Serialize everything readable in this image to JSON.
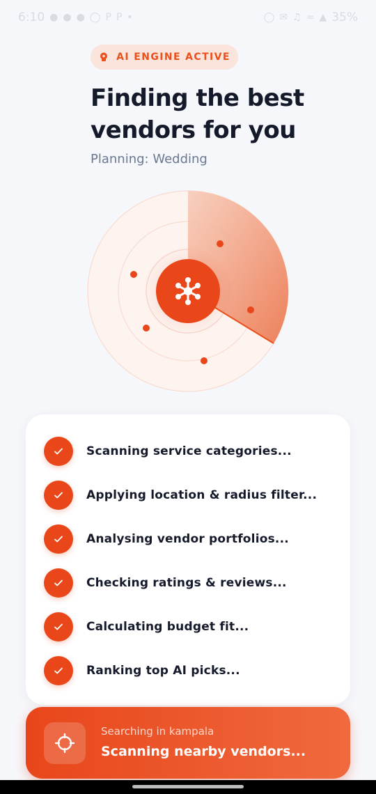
{
  "status_bar": {
    "time": "6:10",
    "left_icons": [
      "snapchat-icon",
      "snapchat-icon",
      "snapchat-icon",
      "alarm-icon",
      "p-icon",
      "p-icon",
      "dot-icon"
    ],
    "right_icons": [
      "alarm-icon",
      "mail-icon",
      "mute-icon",
      "wifi-icon",
      "signal-icon"
    ],
    "battery": "35%"
  },
  "badge": {
    "label": "AI ENGINE ACTIVE",
    "icon": "brain-icon"
  },
  "title": "Finding the best vendors for you",
  "subtitle": "Planning: Wedding",
  "radar": {
    "center_icon": "network-hub-icon",
    "accent": "#e9471a"
  },
  "checklist": {
    "items": [
      {
        "label": "Scanning service categories...",
        "done": true
      },
      {
        "label": "Applying location & radius filter...",
        "done": true
      },
      {
        "label": "Analysing vendor portfolios...",
        "done": true
      },
      {
        "label": "Checking ratings & reviews...",
        "done": true
      },
      {
        "label": "Calculating budget fit...",
        "done": true
      },
      {
        "label": "Ranking top AI picks...",
        "done": true
      }
    ]
  },
  "banner": {
    "icon": "crosshair-icon",
    "sub": "Searching in kampala",
    "main": "Scanning nearby vendors..."
  },
  "colors": {
    "accent": "#e9471a",
    "background": "#f6f7fb",
    "text": "#151a2b",
    "muted": "#6a7890"
  }
}
